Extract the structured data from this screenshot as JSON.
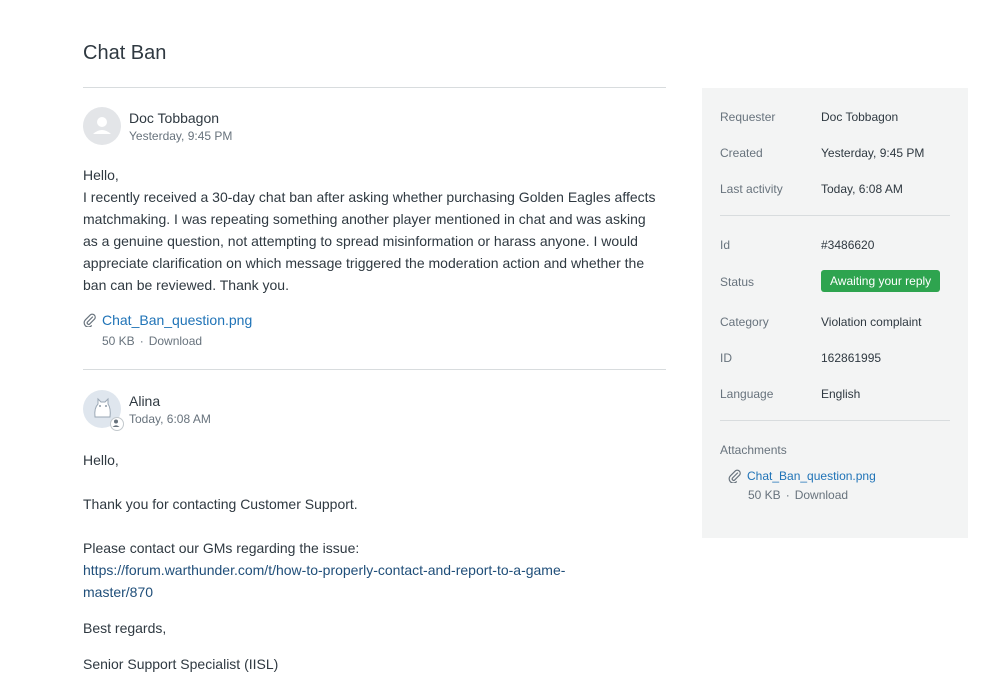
{
  "page": {
    "title": "Chat Ban"
  },
  "comments": [
    {
      "author": "Doc Tobbagon",
      "time": "Yesterday, 9:45 PM",
      "body": [
        "Hello,",
        "I recently received a 30-day chat ban after asking whether purchasing Golden Eagles affects",
        "matchmaking. I was repeating something another player mentioned in chat and was asking",
        "as a genuine question, not attempting to spread misinformation or harass anyone. I would",
        "appreciate clarification on which message triggered the moderation action and whether the",
        "ban can be reviewed. Thank you."
      ],
      "attachment": {
        "name": "Chat_Ban_question.png",
        "size": "50 KB",
        "download": "Download"
      }
    },
    {
      "author": "Alina",
      "time": "Today, 6:08 AM",
      "greeting": "Hello,",
      "thanks": "Thank you for contacting Customer Support.",
      "contact": "Please contact our GMs regarding the issue:",
      "link_line1": "https://forum.warthunder.com/t/how-to-properly-contact-and-report-to-a-game-",
      "link_line2": "master/870",
      "regards": "Best regards,",
      "signature": "Senior Support Specialist (IISL)"
    }
  ],
  "sidebar": {
    "requester_label": "Requester",
    "requester": "Doc Tobbagon",
    "created_label": "Created",
    "created": "Yesterday, 9:45 PM",
    "last_activity_label": "Last activity",
    "last_activity": "Today, 6:08 AM",
    "id_label": "Id",
    "id": "#3486620",
    "status_label": "Status",
    "status": "Awaiting your reply",
    "category_label": "Category",
    "category": "Violation complaint",
    "game_id_label": "ID",
    "game_id": "162861995",
    "language_label": "Language",
    "language": "English",
    "attachments_label": "Attachments",
    "attachment": {
      "name": "Chat_Ban_question.png",
      "size": "50 KB",
      "download": "Download"
    }
  },
  "colors": {
    "link": "#1f73b7",
    "status_green": "#2ea44f",
    "sidebar_bg": "#f3f4f4",
    "muted_text": "#68737d"
  },
  "icons": [
    "user-avatar-icon",
    "agent-avatar-icon",
    "agent-badge-icon",
    "paperclip-icon"
  ]
}
